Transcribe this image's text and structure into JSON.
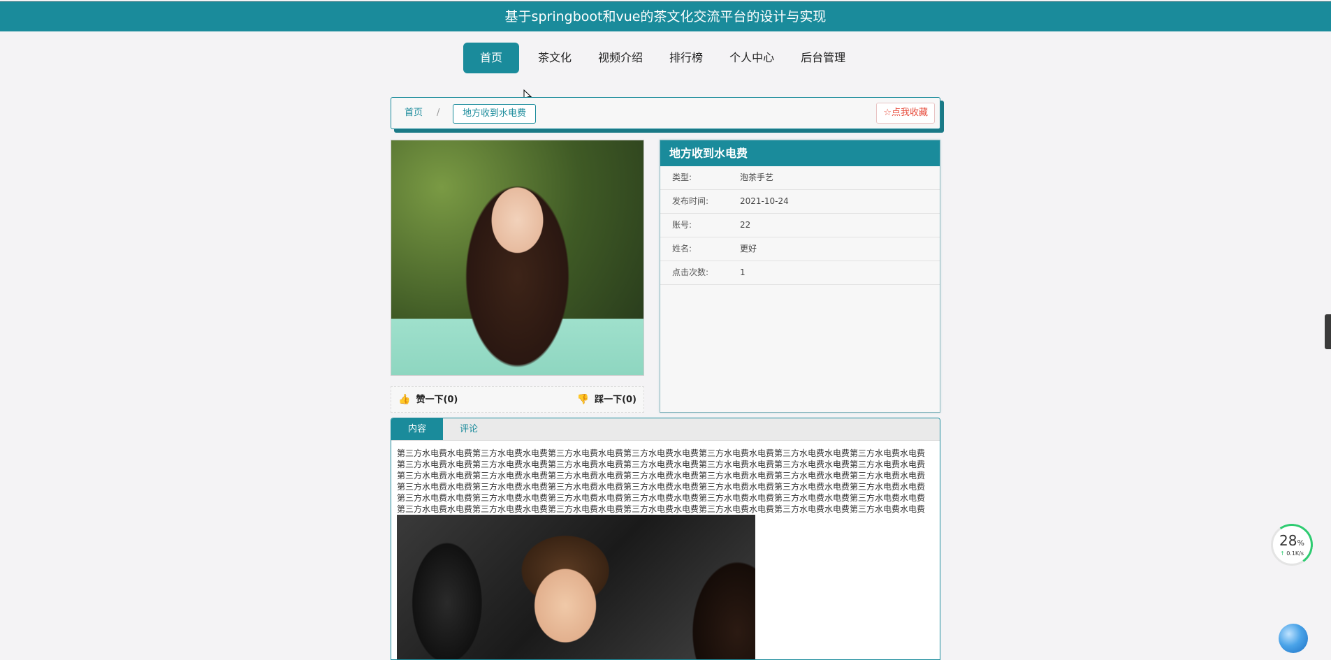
{
  "header": {
    "title": "基于springboot和vue的茶文化交流平台的设计与实现"
  },
  "nav": {
    "items": [
      {
        "label": "首页",
        "active": true
      },
      {
        "label": "茶文化"
      },
      {
        "label": "视频介绍"
      },
      {
        "label": "排行榜"
      },
      {
        "label": "个人中心"
      },
      {
        "label": "后台管理"
      }
    ]
  },
  "breadcrumb": {
    "home": "首页",
    "separator": "/",
    "current": "地方收到水电费"
  },
  "favorite": {
    "label": "☆点我收藏"
  },
  "vote": {
    "like": "赞一下(0)",
    "dislike": "踩一下(0)"
  },
  "info": {
    "title": "地方收到水电费",
    "rows": [
      {
        "key": "类型:",
        "value": "泡茶手艺"
      },
      {
        "key": "发布时间:",
        "value": "2021-10-24"
      },
      {
        "key": "账号:",
        "value": "22"
      },
      {
        "key": "姓名:",
        "value": "更好"
      },
      {
        "key": "点击次数:",
        "value": "1"
      }
    ]
  },
  "tabs": [
    {
      "label": "内容",
      "active": true
    },
    {
      "label": "评论"
    }
  ],
  "content": {
    "text": "第三方水电费水电费第三方水电费水电费第三方水电费水电费第三方水电费水电费第三方水电费水电费第三方水电费水电费第三方水电费水电费第三方水电费水电费第三方水电费水电费第三方水电费水电费第三方水电费水电费第三方水电费水电费第三方水电费水电费第三方水电费水电费第三方水电费水电费第三方水电费水电费第三方水电费水电费第三方水电费水电费第三方水电费水电费第三方水电费水电费第三方水电费水电费第三方水电费水电费第三方水电费水电费第三方水电费水电费第三方水电费水电费第三方水电费水电费第三方水电费水电费第三方水电费水电费第三方水电费水电费第三方水电费水电费第三方水电费水电费第三方水电费水电费第三方水电费水电费第三方水电费水电费第三方水电费水电费第三方水电费水电费第三方水电费水电费第三方水电费水电费第三方水电费水电费第三方水电费水电费第三方水电费水电费第三方水电费水电费第三方水电费水电费第三方水电费水电费"
  },
  "widget": {
    "percent": "28",
    "percent_unit": "%",
    "rate": "0.1K/s",
    "rate_arrow": "↑"
  },
  "colors": {
    "brand": "#1a8b9b",
    "favorite": "#e74c3c",
    "progress": "#2ecc71"
  }
}
